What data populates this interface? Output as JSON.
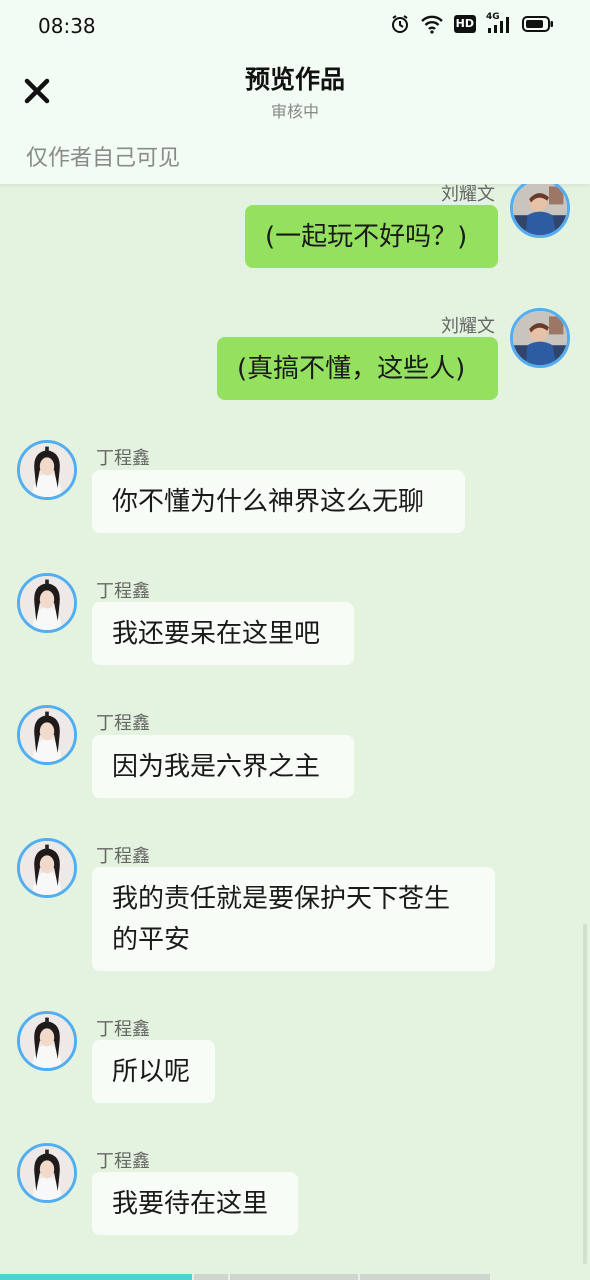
{
  "status_bar": {
    "time": "08:38",
    "icons": [
      "alarm-icon",
      "wifi-icon",
      "hd-icon",
      "signal-4g-icon",
      "battery-icon"
    ],
    "network_label": "4G",
    "hd_label": "HD"
  },
  "header": {
    "close_icon": "close-icon",
    "title": "预览作品",
    "subtitle": "审核中",
    "visibility_note": "仅作者自己可见"
  },
  "colors": {
    "background": "#e4f3df",
    "header_bg": "#f2fcf2",
    "right_bubble": "#94e05f",
    "left_bubble": "#f7fdf6",
    "avatar_border": "#52aef0",
    "progress_accent": "#4fd0d3"
  },
  "messages": [
    {
      "side": "right",
      "name": "刘耀文",
      "text": "(一起玩不好吗？)"
    },
    {
      "side": "right",
      "name": "刘耀文",
      "text": "(真搞不懂，这些人)"
    },
    {
      "side": "left",
      "name": "丁程鑫",
      "text": "你不懂为什么神界这么无聊"
    },
    {
      "side": "left",
      "name": "丁程鑫",
      "text": "我还要呆在这里吧"
    },
    {
      "side": "left",
      "name": "丁程鑫",
      "text": "因为我是六界之主"
    },
    {
      "side": "left",
      "name": "丁程鑫",
      "text": "我的责任就是要保护天下苍生的平安"
    },
    {
      "side": "left",
      "name": "丁程鑫",
      "text": "所以呢"
    },
    {
      "side": "left",
      "name": "丁程鑫",
      "text": "我要待在这里"
    }
  ]
}
